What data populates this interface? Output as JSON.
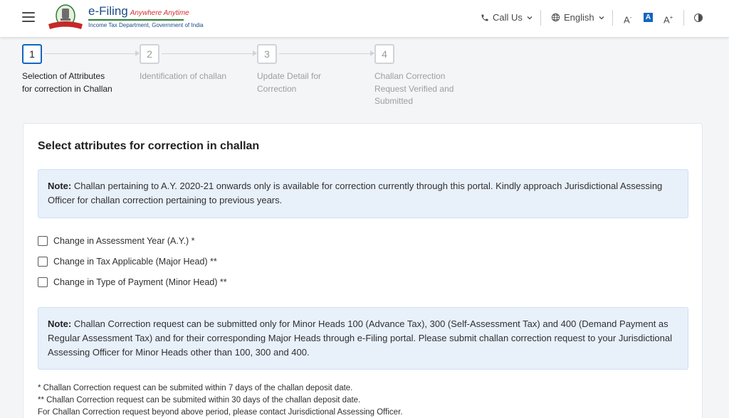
{
  "header": {
    "logo_title": "e-Filing",
    "logo_tagline": "Anywhere Anytime",
    "logo_subtitle": "Income Tax Department, Government of India",
    "call_us": "Call Us",
    "language": "English",
    "font_decrease": "A",
    "font_decrease_mark": "-",
    "font_normal": "A",
    "font_increase": "A",
    "font_increase_mark": "+",
    "icons": [
      "menu-icon",
      "phone-icon",
      "chevron-down-icon",
      "globe-icon",
      "contrast-icon"
    ]
  },
  "stepper": {
    "steps": [
      {
        "number": "1",
        "label": "Selection of Attributes for correction in Challan",
        "active": true
      },
      {
        "number": "2",
        "label": "Identification of challan",
        "active": false
      },
      {
        "number": "3",
        "label": "Update Detail for Correction",
        "active": false
      },
      {
        "number": "4",
        "label": "Challan Correction Request Verified and Submitted",
        "active": false
      }
    ]
  },
  "form": {
    "title": "Select attributes for correction in challan",
    "note1_label": "Note:",
    "note1_text": " Challan pertaining to A.Y. 2020-21 onwards only is available for correction currently through this portal. Kindly approach Jurisdictional Assessing Officer for challan correction pertaining to previous years.",
    "options": [
      {
        "label": "Change in Assessment Year (A.Y.) *",
        "checked": false
      },
      {
        "label": "Change in Tax Applicable (Major Head) **",
        "checked": false
      },
      {
        "label": "Change in Type of Payment (Minor Head) **",
        "checked": false
      }
    ],
    "note2_label": "Note:",
    "note2_text": " Challan Correction request can be submitted only for Minor Heads 100 (Advance Tax), 300 (Self-Assessment Tax) and 400 (Demand Payment as Regular Assessment Tax) and for their corresponding Major Heads through e-Filing portal. Please submit challan correction request to your Jurisdictional Assessing Officer for Minor Heads other than 100, 300 and 400.",
    "footnotes": [
      "* Challan Correction request can be submited within 7 days of the challan deposit date.",
      "** Challan Correction request can be submited within 30 days of the challan deposit date.",
      "For Challan Correction request beyond above period, please contact Jurisdictional Assessing Officer."
    ]
  },
  "colors": {
    "accent": "#1565c0",
    "note_bg": "#e8f0fa",
    "page_bg": "#f4f5f7"
  }
}
